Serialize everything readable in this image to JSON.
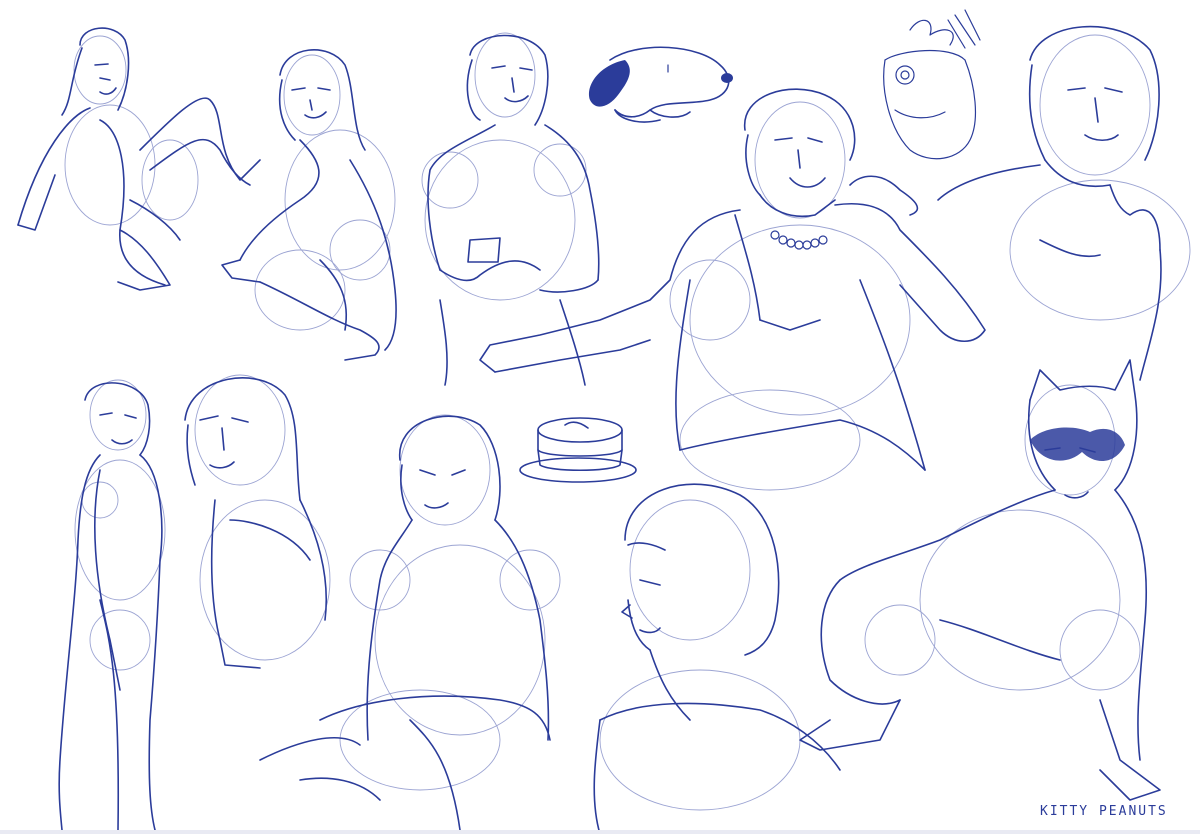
{
  "artwork": {
    "signature": "KITTY PEANUTS",
    "palette": {
      "ink": "#2b3c9a",
      "construction": "#7b86c4",
      "paper": "#ffffff"
    }
  }
}
